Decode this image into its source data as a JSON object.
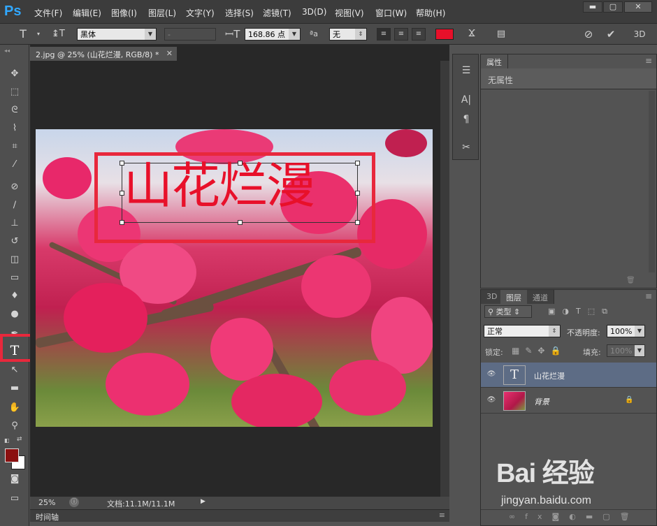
{
  "app": {
    "logo": "Ps"
  },
  "menu": [
    "文件(F)",
    "编辑(E)",
    "图像(I)",
    "图层(L)",
    "文字(Y)",
    "选择(S)",
    "滤镜(T)",
    "3D(D)",
    "视图(V)",
    "窗口(W)",
    "帮助(H)"
  ],
  "window_controls": {
    "minimize": "▬",
    "maximize": "▢",
    "close": "✕"
  },
  "options": {
    "font_family": "黑体",
    "font_style": "-",
    "font_size": "168.86 点",
    "antialias_label": "ªa",
    "antialias": "无",
    "text_color": "#e8102a",
    "threed": "3D"
  },
  "document": {
    "tab_title": "2.jpg @ 25% (山花烂漫, RGB/8) *",
    "text_content": "山花烂漫",
    "zoom": "25%",
    "doc_size": "文档:11.1M/11.1M"
  },
  "timeline": {
    "label": "时间轴"
  },
  "tools": {
    "foreground_color": "#8b1010",
    "background_color": "#ffffff"
  },
  "properties_panel": {
    "tab": "属性",
    "empty_text": "无属性"
  },
  "layers_panel": {
    "tabs": [
      "3D",
      "图层",
      "通道"
    ],
    "filter_label": "类型",
    "blend_mode": "正常",
    "opacity_label": "不透明度:",
    "opacity": "100%",
    "lock_label": "锁定:",
    "fill_label": "填充:",
    "fill": "100%",
    "layers": [
      {
        "name": "山花烂漫",
        "type": "text",
        "selected": true
      },
      {
        "name": "背景",
        "type": "image",
        "selected": false,
        "locked": true
      }
    ]
  },
  "watermark": {
    "brand": "Bai 经验",
    "url": "jingyan.baidu.com"
  }
}
